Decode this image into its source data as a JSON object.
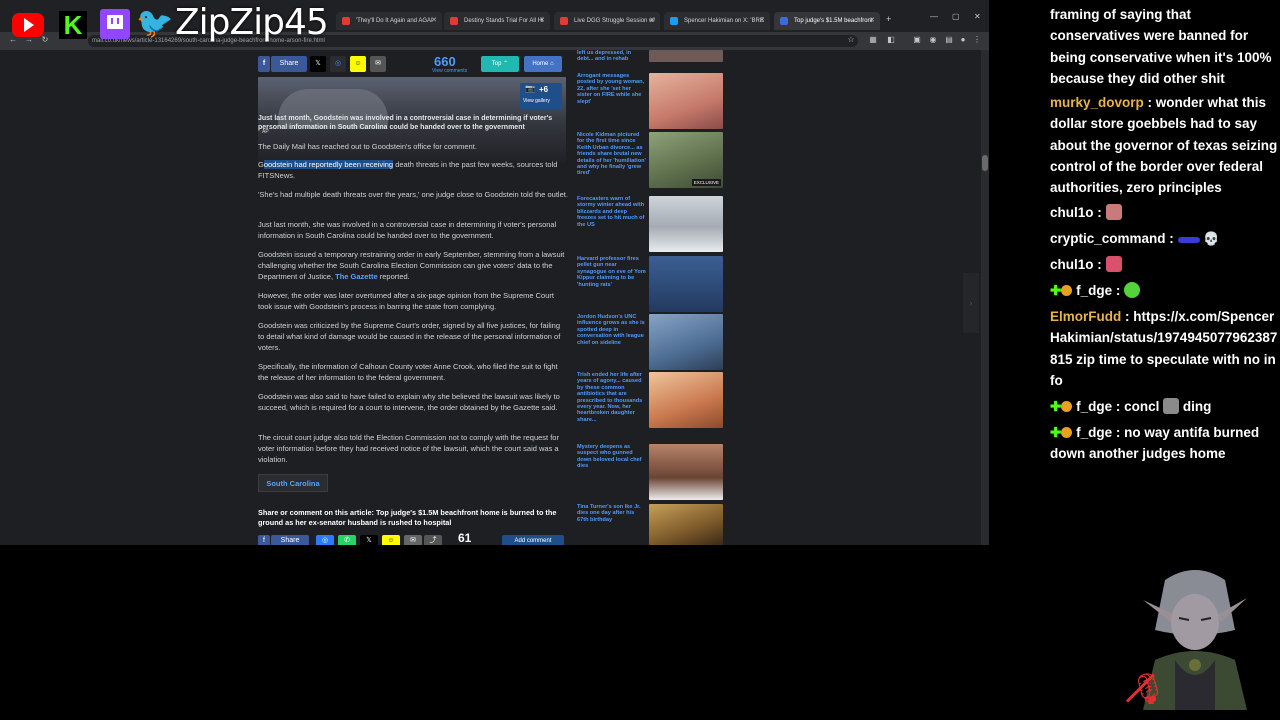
{
  "browser": {
    "tabs": [
      {
        "label": "'They'll Do It Again and AGAI",
        "color": "#e53935"
      },
      {
        "label": "Destiny Stands Trial For All Hi",
        "color": "#e53935"
      },
      {
        "label": "Live DGG Struggle Session w/",
        "color": "#e53935"
      },
      {
        "label": "Spencer Hakimian on X: 'BRE",
        "color": "#1d9bf0"
      },
      {
        "label": "Top judge's $1.5M beachfront",
        "color": "#3f6ad8"
      }
    ],
    "url": "mail.co.uk/news/article-13164269/south-carolina-judge-beachfront-home-arson-fire.html"
  },
  "article": {
    "sharebar": {
      "share_label": "Share",
      "comments_count": "660",
      "comments_label": "View comments",
      "top_label": "Top",
      "home_label": "Home"
    },
    "photo": {
      "gallery_count": "+6",
      "gallery_label": "View gallery",
      "credit": "AP"
    },
    "caption": "Just last month, Goodstein was involved in a controversial case in determining if voter's personal information in South Carolina could be handed over to the government",
    "p1": "The Daily Mail has reached out to Goodstein's office for comment.",
    "p2_pre": "G",
    "p2_highlight": "oodstein had reportedly been receiving",
    "p2_post": " death threats in the past few weeks, sources told FITSNews.",
    "p3": "'She's had multiple death threats over the years,' one judge close to Goodstein told the outlet.",
    "p4": "Just last month, she was involved in a controversial case in determining if voter's personal information in South Carolina could be handed over to the government.",
    "p5_pre": "Goodstein issued a temporary restraining order in early September, stemming from a lawsuit challenging whether the South Carolina Election Commission can give voters' data to the Department of Justice, ",
    "p5_link": "The Gazette",
    "p5_post": " reported.",
    "p6": "However, the order was later overturned after a six-page opinion from the Supreme Court took issue with Goodstein's process in barring the state from complying.",
    "p7": "Goodstein was criticized by the Supreme Court's order, signed by all five justices, for failing to detail what kind of damage would be caused in the release of the personal information of voters.",
    "p8": "Specifically, the information of Calhoun County voter Anne Crook, who filed the suit to fight the release of her information to the federal government.",
    "p9": "Goodstein was also said to have failed to explain why she believed the lawsuit was likely to succeed, which is required for a court to intervene, the order obtained by the Gazette said.",
    "p10": "The circuit court judge also told the Election Commission not to comply with the request for voter information before they had received notice of the lawsuit, which the court said was a violation.",
    "topic": "South Carolina",
    "share_heading": "Share or comment on this article: Top judge's $1.5M beachfront home is burned to the ground as her ex-senator husband is rushed to hospital",
    "bottom_share_label": "Share",
    "bottom_count": "61",
    "add_comment": "Add comment"
  },
  "sidebar": [
    {
      "text": "left us depressed, in debt... and in rehab",
      "color": "#6e5a56"
    },
    {
      "text": "Arrogant messages posted by young woman, 22, after she 'set her sister on FIRE while she slept'",
      "color": "#c98b7a"
    },
    {
      "text": "Nicole Kidman pictured for the first time since Keith Urban divorce... as friends share brutal new details of her 'humiliation' and why he finally 'grew tired'",
      "color": "#6f7d5e",
      "badge": "EXCLUSIVE"
    },
    {
      "text": "Forecasters warn of stormy winter ahead with blizzards and deep freezes set to hit much of the US",
      "color": "#b9bfc7"
    },
    {
      "text": "Harvard professor fires pellet gun near synagogue on eve of Yom Kippur claiming to be 'hunting rats'",
      "color": "#2d4a78"
    },
    {
      "text": "Jordon Hudson's UNC influence grows as she is spotted deep in conversation with league chief on sideline",
      "color": "#5a7fa8"
    },
    {
      "text": "Trish ended her life after years of agony... caused by these common antibiotics that are prescribed to thousands every year. Now, her heartbroken daughter share...",
      "color": "#d49a72"
    },
    {
      "text": "Mystery deepens as suspect who gunned down beloved local chef dies",
      "color": "#8a5a42"
    },
    {
      "text": "Tina Turner's son Ike Jr. dies one day after his 67th birthday",
      "color": "#a07a3c"
    }
  ],
  "chat": {
    "first_message": "framing of saying that conservatives were banned for being conservative when it's 100% because they did other shit",
    "messages": [
      {
        "user": "murky_dovorp",
        "color": "#e8b34a",
        "text": "wonder what this dollar store goebbels had to say about the governor of texas seizing control of the border over federal authorities, zero principles"
      },
      {
        "user": "chul1o",
        "color": "#ffffff",
        "text": ""
      },
      {
        "user": "cryptic_command",
        "color": "#ffffff",
        "text": ""
      },
      {
        "user": "chul1o",
        "color": "#ffffff",
        "text": ""
      },
      {
        "user": "f_dge",
        "color": "#ffffff",
        "text": ""
      },
      {
        "user": "ElmorFudd",
        "color": "#e8b34a",
        "text": "https://x.com/SpencerHakimian/status/1974945077962387815 zip time to speculate with no info"
      },
      {
        "user": "f_dge",
        "color": "#ffffff",
        "text": "concl",
        "text2": "ding"
      },
      {
        "user": "f_dge",
        "color": "#ffffff",
        "text": "no way antifa burned down another judges home"
      }
    ],
    "separator": " : "
  },
  "overlay": {
    "streamer_name": "ZipZip45"
  },
  "colors": {
    "link": "#5aa0ff",
    "highlight": "#1d4f8c",
    "youtube": "#ff0000",
    "twitch": "#9146ff",
    "twitter": "#1d9bf0",
    "kick": "#53fc18"
  }
}
